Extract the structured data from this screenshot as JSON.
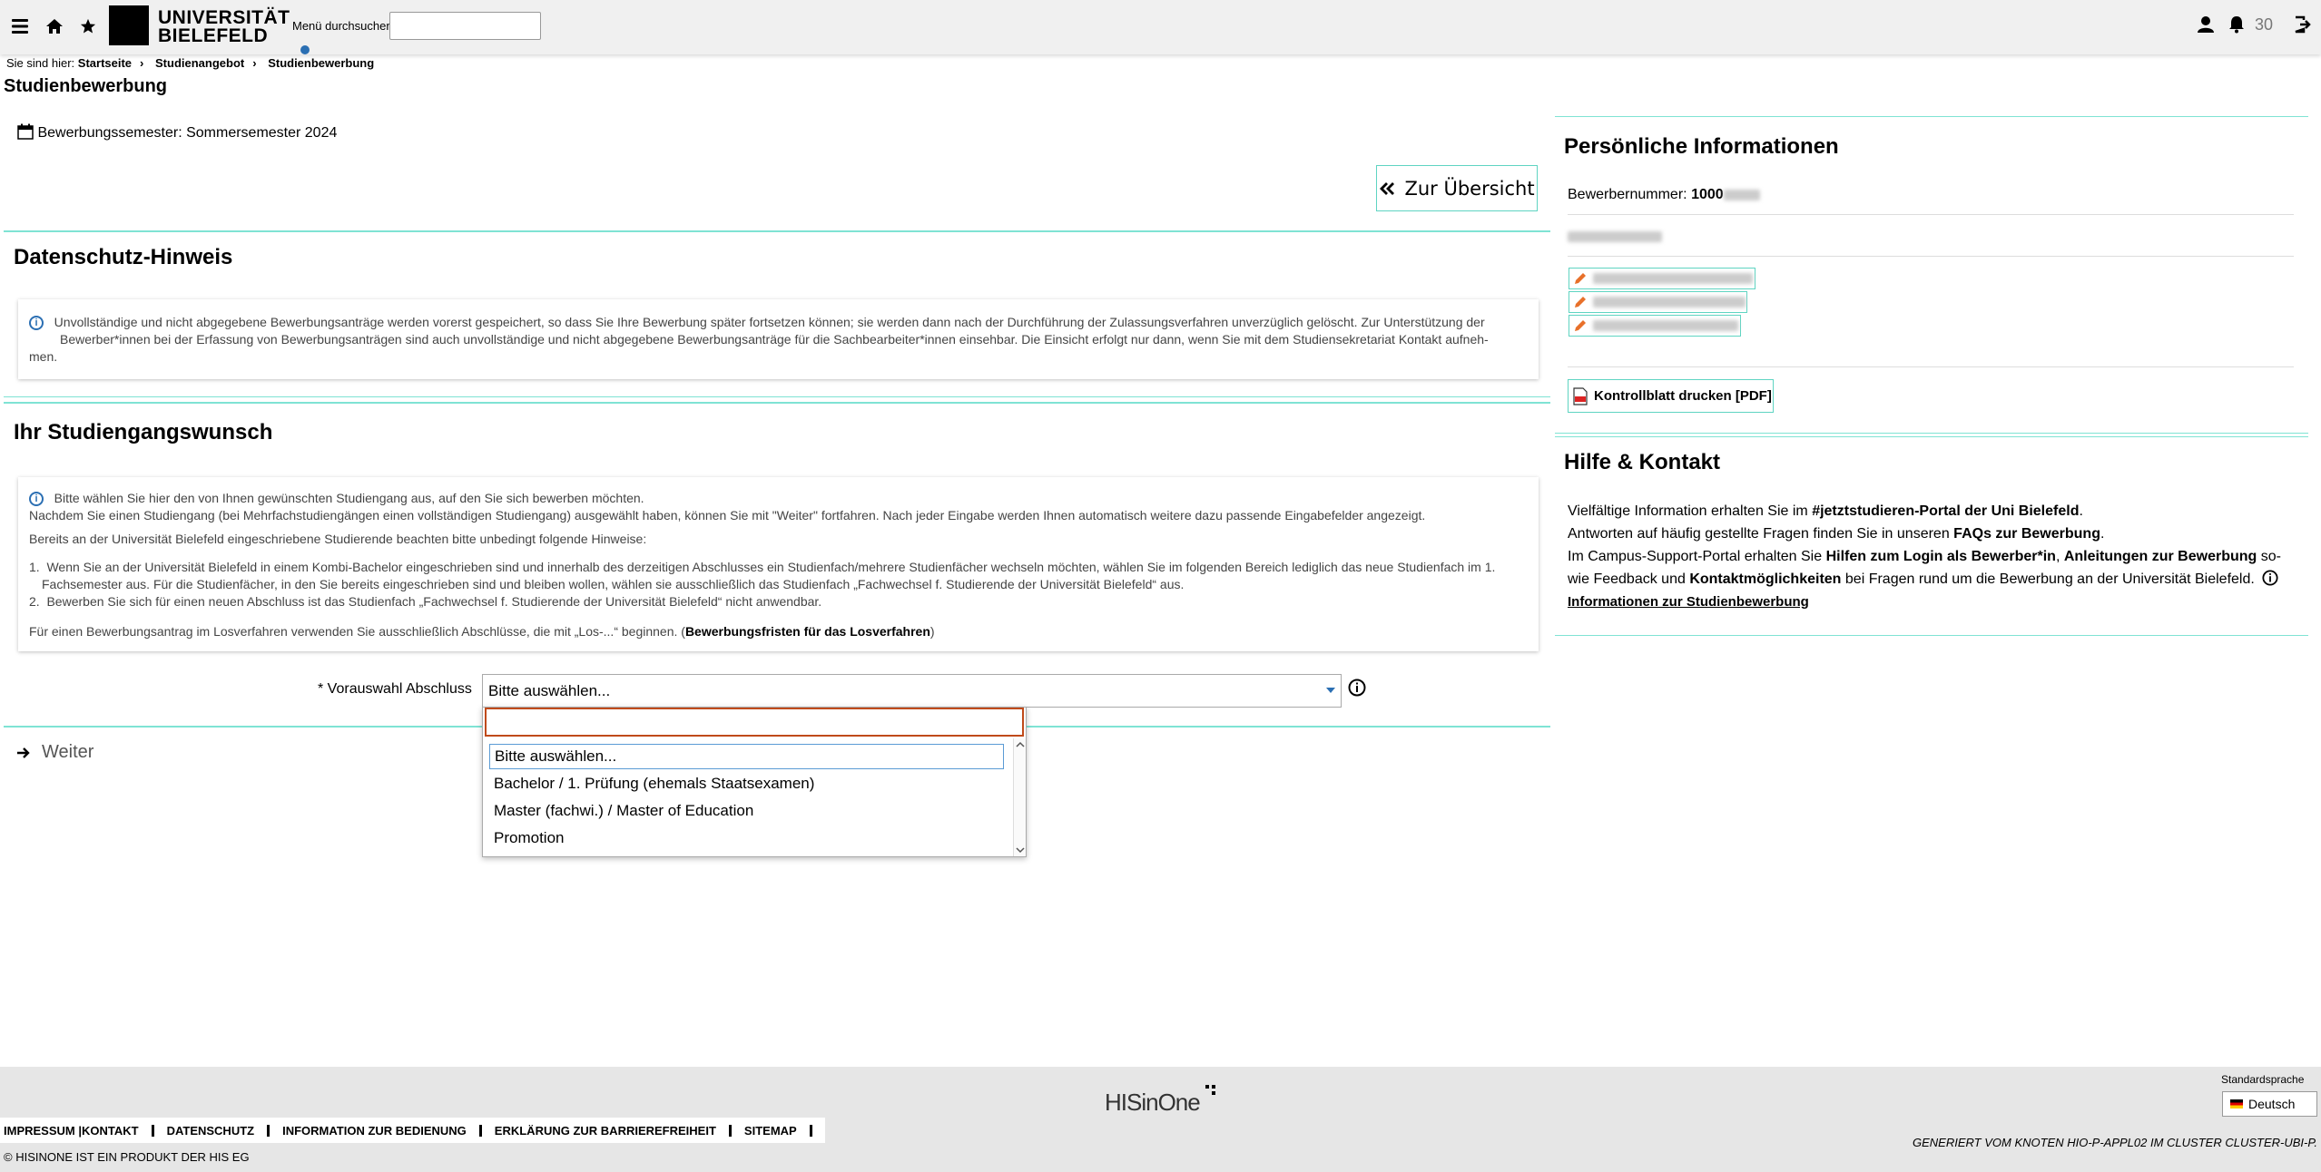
{
  "header": {
    "logo_line1": "UNIVERSITÄT",
    "logo_line2": "BIELEFELD",
    "search_label": "Menü durchsuchen",
    "search_value": "",
    "notification_count": "30"
  },
  "breadcrumb": {
    "prefix": "Sie sind hier:",
    "items": [
      "Startseite",
      "Studienangebot",
      "Studienbewerbung"
    ]
  },
  "page": {
    "title": "Studienbewerbung",
    "semester": "Bewerbungssemester: Sommersemester 2024",
    "overview_button": "Zur Übersicht"
  },
  "privacy": {
    "heading": "Datenschutz-Hinweis",
    "line1": "Unvollständige und nicht abgegebene Bewerbungsanträge werden vorerst gespeichert, so dass Sie Ihre Bewerbung später fortsetzen können; sie werden dann nach der Durchführung der Zulassungsverfahren unverzüglich gelöscht. Zur Unterstützung der",
    "line2": "Bewerber*innen bei der Erfassung von Bewerbungsanträgen sind auch unvollständige und nicht abgegebene Bewerbungsanträge für die Sachbearbeiter*innen einsehbar. Die Einsicht erfolgt nur dann, wenn Sie mit dem Studiensekretariat Kontakt aufneh-",
    "line3": "men."
  },
  "study": {
    "heading": "Ihr Studiengangswunsch",
    "intro1": "Bitte wählen Sie hier den von Ihnen gewünschten Studiengang aus, auf den Sie sich bewerben möchten.",
    "intro2": "Nachdem Sie einen Studiengang (bei Mehrfachstudiengängen einen vollständigen Studiengang) ausgewählt haben, können Sie mit \"Weiter\" fortfahren. Nach jeder Eingabe werden Ihnen automatisch weitere dazu passende Eingabefelder angezeigt.",
    "intro3": "Bereits an der Universität Bielefeld eingeschriebene Studierende beachten bitte unbedingt folgende Hinweise:",
    "hint1a": "Wenn Sie an der Universität Bielefeld in einem Kombi-Bachelor eingeschrieben sind und innerhalb des derzeitigen Abschlusses ein Studienfach/mehrere Studienfächer wechseln möchten, wählen Sie im folgenden Bereich lediglich das neue Studienfach im 1.",
    "hint1b": "Fachsemester aus. Für die Studienfächer, in den Sie bereits eingeschrieben sind und bleiben wollen, wählen sie ausschließlich das Studienfach „Fachwechsel f. Studierende der Universität Bielefeld“ aus.",
    "hint2": "Bewerben Sie sich für einen neuen Abschluss ist das Studienfach „Fachwechsel f. Studierende der Universität Bielefeld“ nicht anwendbar.",
    "lottery_text": "Für einen Bewerbungsantrag im Losverfahren verwenden Sie ausschließlich Abschlüsse, die mit „Los-...“ beginnen. (",
    "lottery_link": "Bewerbungsfristen für das Losverfahren",
    "lottery_close": ")"
  },
  "form": {
    "label": "* Vorauswahl Abschluss",
    "selected": "Bitte auswählen...",
    "search_value": "",
    "options": [
      "Bitte auswählen...",
      "Bachelor / 1. Prüfung (ehemals Staatsexamen)",
      "Master (fachwi.) / Master of Education",
      "Promotion"
    ],
    "next_button": "Weiter"
  },
  "personal": {
    "heading": "Persönliche Informationen",
    "applicant_label": "Bewerbernummer:",
    "applicant_number": "1000",
    "pdf_button": "Kontrollblatt drucken [PDF]"
  },
  "help": {
    "heading": "Hilfe & Kontakt",
    "t1": "Vielfältige Information erhalten Sie im ",
    "l1": "#jetztstudieren-Portal der Uni Bielefeld",
    "t1end": ".",
    "t2": "Antworten auf häufig gestellte Fragen finden Sie in unseren ",
    "l2": "FAQs zur Bewerbung",
    "t2end": ".",
    "t3": "Im Campus-Support-Portal erhalten Sie ",
    "l3": "Hilfen zum Login als Bewerber*in",
    "t3b": ", ",
    "l4": "Anleitungen zur Bewerbung",
    "t3c": " so-",
    "t4": "wie Feedback und ",
    "l5": "Kontaktmöglichkeiten",
    "t4b": " bei Fragen rund um die Bewerbung an der Universität Bielefeld.",
    "l6": "Informationen zur Studienbewerbung"
  },
  "footer": {
    "brand": "HISinOne",
    "lang_label": "Standardsprache",
    "lang_value": "Deutsch",
    "links": [
      "IMPRESSUM |KONTAKT",
      "DATENSCHUTZ",
      "INFORMATION ZUR BEDIENUNG",
      "ERKLÄRUNG ZUR BARRIEREFREIHEIT",
      "SITEMAP"
    ],
    "copyright": "© HISINONE IST EIN PRODUKT DER HIS EG",
    "generated": "GENERIERT VOM KNOTEN HIO-P-APPL02 IM CLUSTER CLUSTER-UBI-P."
  },
  "colors": {
    "accent_rule": "#7fe3d4",
    "info_blue": "#2b6fb3",
    "focus_orange": "#c04a1a",
    "pencil_orange": "#e8702a"
  }
}
